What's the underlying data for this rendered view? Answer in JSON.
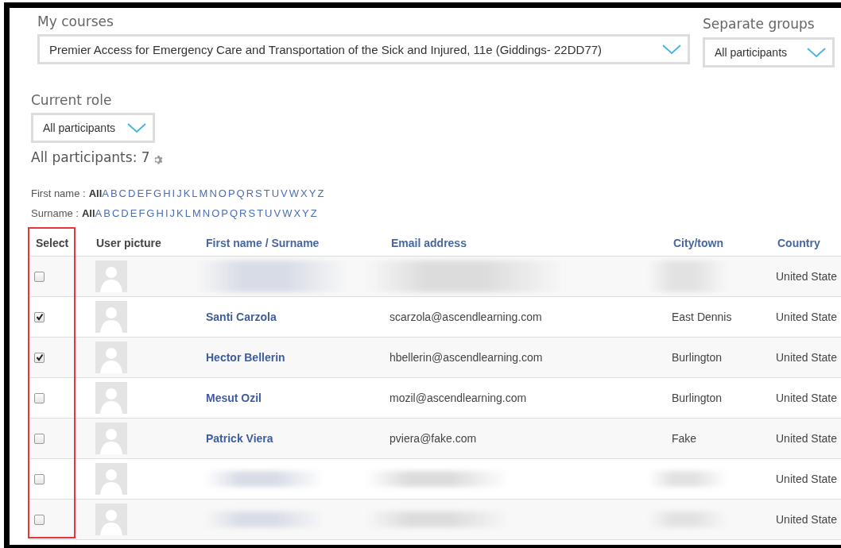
{
  "course_selector": {
    "label": "My courses",
    "value": "Premier Access for Emergency Care and Transportation of the Sick and Injured, 11e (Giddings- 22DD77)"
  },
  "group_selector": {
    "label": "Separate groups",
    "value": "All participants"
  },
  "role_selector": {
    "label": "Current role",
    "value": "All participants"
  },
  "participants_heading": "All participants: 7",
  "initial_filters": [
    {
      "label": "First name :",
      "options": [
        {
          "text": "All",
          "selected": true
        },
        {
          "text": "A",
          "selected": false
        },
        {
          "text": "B",
          "selected": false
        },
        {
          "text": "C",
          "selected": false
        },
        {
          "text": "D",
          "selected": false
        },
        {
          "text": "E",
          "selected": false
        },
        {
          "text": "F",
          "selected": false
        },
        {
          "text": "G",
          "selected": false
        },
        {
          "text": "H",
          "selected": false
        },
        {
          "text": "I",
          "selected": false
        },
        {
          "text": "J",
          "selected": false
        },
        {
          "text": "K",
          "selected": false
        },
        {
          "text": "L",
          "selected": false
        },
        {
          "text": "M",
          "selected": false
        },
        {
          "text": "N",
          "selected": false
        },
        {
          "text": "O",
          "selected": false
        },
        {
          "text": "P",
          "selected": false
        },
        {
          "text": "Q",
          "selected": false
        },
        {
          "text": "R",
          "selected": false
        },
        {
          "text": "S",
          "selected": false
        },
        {
          "text": "T",
          "selected": false
        },
        {
          "text": "U",
          "selected": false
        },
        {
          "text": "V",
          "selected": false
        },
        {
          "text": "W",
          "selected": false
        },
        {
          "text": "X",
          "selected": false
        },
        {
          "text": "Y",
          "selected": false
        },
        {
          "text": "Z",
          "selected": false
        }
      ]
    },
    {
      "label": "Surname :",
      "options": [
        {
          "text": "All",
          "selected": true
        },
        {
          "text": "A",
          "selected": false
        },
        {
          "text": "B",
          "selected": false
        },
        {
          "text": "C",
          "selected": false
        },
        {
          "text": "D",
          "selected": false
        },
        {
          "text": "E",
          "selected": false
        },
        {
          "text": "F",
          "selected": false
        },
        {
          "text": "G",
          "selected": false
        },
        {
          "text": "H",
          "selected": false
        },
        {
          "text": "I",
          "selected": false
        },
        {
          "text": "J",
          "selected": false
        },
        {
          "text": "K",
          "selected": false
        },
        {
          "text": "L",
          "selected": false
        },
        {
          "text": "M",
          "selected": false
        },
        {
          "text": "N",
          "selected": false
        },
        {
          "text": "O",
          "selected": false
        },
        {
          "text": "P",
          "selected": false
        },
        {
          "text": "Q",
          "selected": false
        },
        {
          "text": "R",
          "selected": false
        },
        {
          "text": "S",
          "selected": false
        },
        {
          "text": "T",
          "selected": false
        },
        {
          "text": "U",
          "selected": false
        },
        {
          "text": "V",
          "selected": false
        },
        {
          "text": "W",
          "selected": false
        },
        {
          "text": "X",
          "selected": false
        },
        {
          "text": "Y",
          "selected": false
        },
        {
          "text": "Z",
          "selected": false
        }
      ]
    }
  ],
  "table": {
    "columns": [
      {
        "label": "Select",
        "kind": "plain",
        "highlighted": true
      },
      {
        "label": "User picture",
        "kind": "plain",
        "highlighted": false
      },
      {
        "label": "First name / Surname",
        "kind": "link",
        "highlighted": false
      },
      {
        "label": "Email address",
        "kind": "link",
        "highlighted": false
      },
      {
        "label": "City/town",
        "kind": "link",
        "highlighted": false
      },
      {
        "label": "Country",
        "kind": "link",
        "highlighted": false
      }
    ],
    "rows": [
      {
        "checked": false,
        "redacted": true,
        "country": "United State"
      },
      {
        "checked": true,
        "redacted": false,
        "name": "Santi Carzola",
        "email": "scarzola@ascendlearning.com",
        "city": "East Dennis",
        "country": "United State"
      },
      {
        "checked": true,
        "redacted": false,
        "name": "Hector Bellerin",
        "email": "hbellerin@ascendlearning.com",
        "city": "Burlington",
        "country": "United State"
      },
      {
        "checked": false,
        "redacted": false,
        "name": "Mesut Ozil",
        "email": "mozil@ascendlearning.com",
        "city": "Burlington",
        "country": "United State"
      },
      {
        "checked": false,
        "redacted": false,
        "name": "Patrick Viera",
        "email": "pviera@fake.com",
        "city": "Fake",
        "country": "United State"
      },
      {
        "checked": false,
        "redacted": true,
        "country": "United State"
      },
      {
        "checked": false,
        "redacted": true,
        "country": "United State"
      }
    ]
  }
}
